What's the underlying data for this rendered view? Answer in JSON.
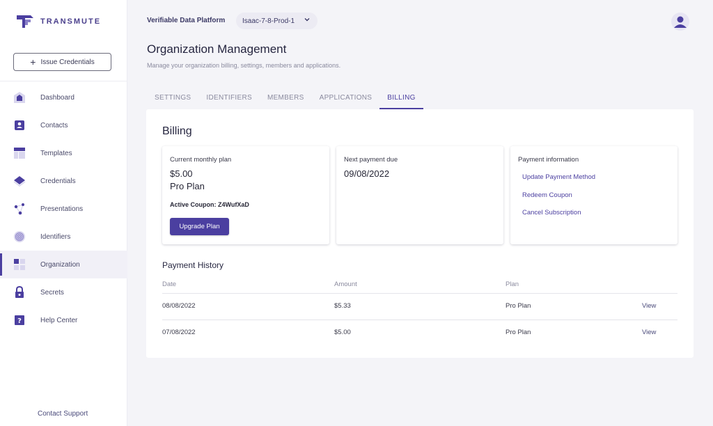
{
  "brand": {
    "name": "TRANSMUTE"
  },
  "sidebar": {
    "issue_button": "Issue Credentials",
    "items": [
      {
        "label": "Dashboard",
        "icon": "home-icon"
      },
      {
        "label": "Contacts",
        "icon": "contact-card-icon"
      },
      {
        "label": "Templates",
        "icon": "template-icon"
      },
      {
        "label": "Credentials",
        "icon": "credential-diamond-icon"
      },
      {
        "label": "Presentations",
        "icon": "share-nodes-icon"
      },
      {
        "label": "Identifiers",
        "icon": "fingerprint-icon"
      },
      {
        "label": "Organization",
        "icon": "grid-icon",
        "active": true
      },
      {
        "label": "Secrets",
        "icon": "lock-icon"
      },
      {
        "label": "Help Center",
        "icon": "question-icon"
      }
    ],
    "contact_support": "Contact Support"
  },
  "header": {
    "platform": "Verifiable Data Platform",
    "org_select": "Isaac-7-8-Prod-1"
  },
  "page": {
    "title": "Organization Management",
    "subtitle": "Manage your organization billing, settings, members and applications."
  },
  "tabs": [
    {
      "label": "SETTINGS"
    },
    {
      "label": "IDENTIFIERS"
    },
    {
      "label": "MEMBERS"
    },
    {
      "label": "APPLICATIONS"
    },
    {
      "label": "BILLING",
      "active": true
    }
  ],
  "billing": {
    "title": "Billing",
    "plan_card": {
      "label": "Current monthly plan",
      "price": "$5.00",
      "plan": "Pro Plan",
      "coupon": "Active Coupon: Z4WufXaD",
      "upgrade": "Upgrade Plan"
    },
    "next_card": {
      "label": "Next payment due",
      "date": "09/08/2022"
    },
    "payment_card": {
      "label": "Payment information",
      "links": [
        "Update Payment Method",
        "Redeem Coupon",
        "Cancel Subscription"
      ]
    },
    "history": {
      "title": "Payment History",
      "columns": [
        "Date",
        "Amount",
        "Plan"
      ],
      "rows": [
        {
          "date": "08/08/2022",
          "amount": "$5.33",
          "plan": "Pro Plan",
          "action": "View"
        },
        {
          "date": "07/08/2022",
          "amount": "$5.00",
          "plan": "Pro Plan",
          "action": "View"
        }
      ]
    }
  },
  "colors": {
    "accent": "#4b3fa0",
    "background": "#f4f4f8"
  }
}
